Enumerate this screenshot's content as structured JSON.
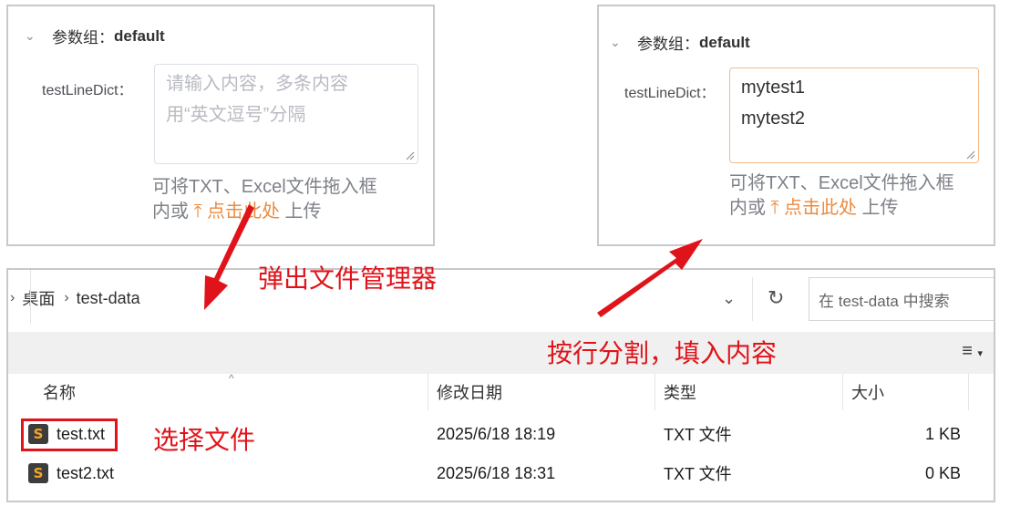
{
  "left_panel": {
    "group_label": "参数组：",
    "group_name": "default",
    "field_label": "testLineDict：",
    "placeholder_line1": "请输入内容，多条内容",
    "placeholder_line2": "用“英文逗号”分隔",
    "hint_line1": "可将TXT、Excel文件拖入框",
    "hint_prefix": "内或 ",
    "hint_link": "点击此处",
    "hint_suffix": " 上传"
  },
  "right_panel": {
    "group_label": "参数组：",
    "group_name": "default",
    "field_label": "testLineDict：",
    "values": [
      "mytest1",
      "mytest2"
    ],
    "hint_line1": "可将TXT、Excel文件拖入框",
    "hint_prefix": "内或 ",
    "hint_link": "点击此处",
    "hint_suffix": " 上传"
  },
  "explorer": {
    "breadcrumb": [
      "桌面",
      "test-data"
    ],
    "search_placeholder": "在 test-data 中搜索",
    "columns": {
      "name": "名称",
      "modified": "修改日期",
      "type": "类型",
      "size": "大小"
    },
    "files": [
      {
        "name": "test.txt",
        "modified": "2025/6/18 18:19",
        "type": "TXT 文件",
        "size": "1 KB",
        "selected": true
      },
      {
        "name": "test2.txt",
        "modified": "2025/6/18 18:31",
        "type": "TXT 文件",
        "size": "0 KB",
        "selected": false
      }
    ],
    "file_icon": "sublime-text-icon"
  },
  "annotations": {
    "open_manager": "弹出文件管理器",
    "split_fill": "按行分割，填入内容",
    "choose_file": "选择文件"
  },
  "colors": {
    "annotation": "#e0131a",
    "link": "#ed8a3e",
    "active_border": "#f3b98a"
  }
}
